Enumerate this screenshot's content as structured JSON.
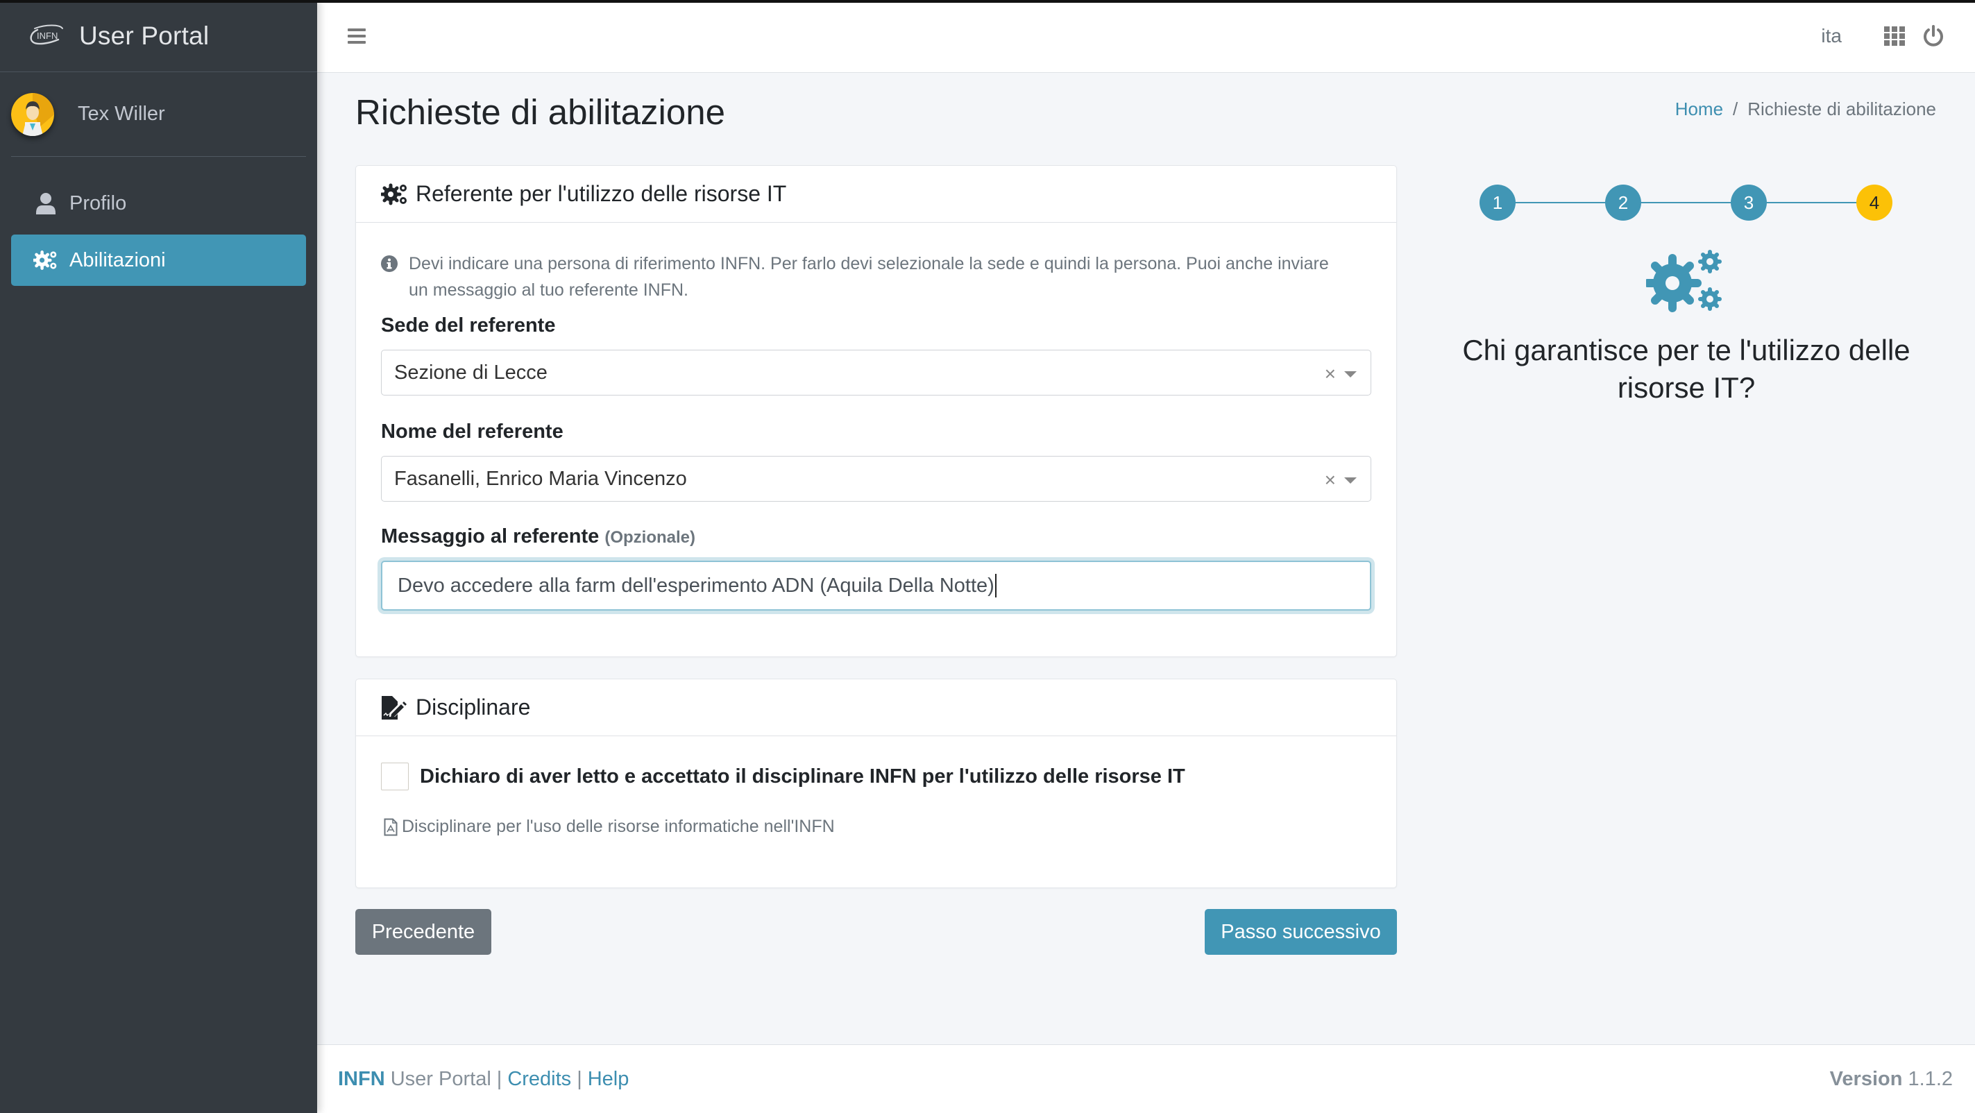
{
  "app": {
    "brand_logo_text": "INFN",
    "brand_title": "User Portal"
  },
  "user": {
    "name": "Tex Willer"
  },
  "sidebar": {
    "items": [
      {
        "label": "Profilo",
        "icon": "user-icon",
        "active": false
      },
      {
        "label": "Abilitazioni",
        "icon": "cogs-icon",
        "active": true
      }
    ]
  },
  "header": {
    "language": "ita",
    "apps_icon": "grid-icon",
    "logout_icon": "power-icon"
  },
  "page": {
    "title": "Richieste di abilitazione",
    "breadcrumb": [
      {
        "label": "Home",
        "link": true
      },
      {
        "label": "Richieste di abilitazione",
        "link": false
      }
    ]
  },
  "referente_card": {
    "title": "Referente per l'utilizzo delle risorse IT",
    "info": "Devi indicare una persona di riferimento INFN. Per farlo devi selezionale la sede e quindi la persona. Puoi anche inviare un messaggio al tuo referente INFN.",
    "sede_label": "Sede del referente",
    "sede_value": "Sezione di Lecce",
    "nome_label": "Nome del referente",
    "nome_value": "Fasanelli, Enrico Maria Vincenzo",
    "messaggio_label": "Messaggio al referente",
    "messaggio_optional": "(Opzionale)",
    "messaggio_value": "Devo accedere alla farm dell'esperimento ADN (Aquila Della Notte)",
    "clear_symbol": "×"
  },
  "disciplinare_card": {
    "title": "Disciplinare",
    "checkbox_label": "Dichiaro di aver letto e accettato il disciplinare INFN per l'utilizzo delle risorse IT",
    "checkbox_checked": false,
    "pdf_link": "Disciplinare per l'uso delle risorse informatiche nell'INFN"
  },
  "buttons": {
    "prev": "Precedente",
    "next": "Passo successivo"
  },
  "wizard": {
    "steps": [
      "1",
      "2",
      "3",
      "4"
    ],
    "current_step": 4,
    "question": "Chi garantisce per te l'utilizzo delle risorse IT?",
    "colors": {
      "done": "#4196b5",
      "current": "#fcc107"
    }
  },
  "footer": {
    "brand": "INFN",
    "product": "User Portal",
    "separator": "|",
    "links": [
      "Credits",
      "Help"
    ],
    "version_label": "Version",
    "version_value": "1.1.2"
  },
  "colors": {
    "accent": "#4196b5",
    "sidebar_bg": "#343a40",
    "secondary_button": "#6c757d"
  }
}
